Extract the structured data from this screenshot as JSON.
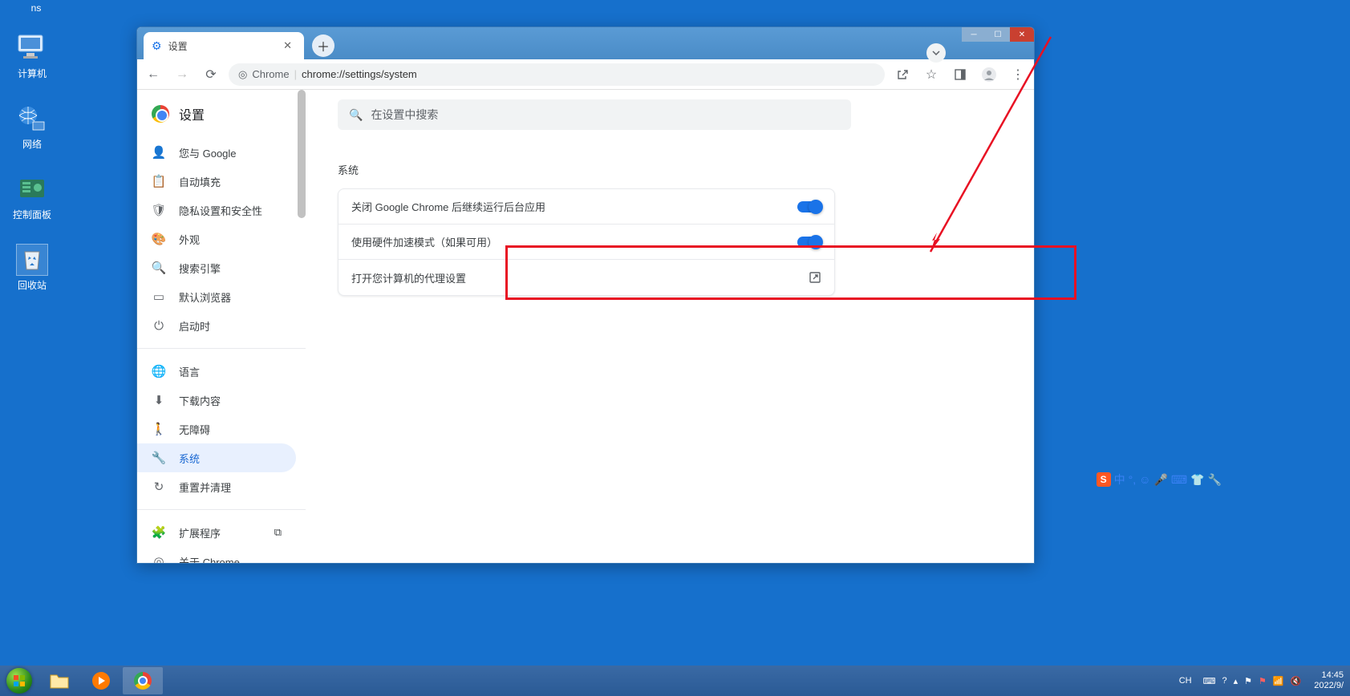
{
  "desktop": {
    "ns_text": "ns",
    "icons": [
      {
        "label": "计算机"
      },
      {
        "label": "网络"
      },
      {
        "label": "控制面板"
      },
      {
        "label": "回收站"
      }
    ]
  },
  "chrome": {
    "tab_title": "设置",
    "address_prefix": "Chrome",
    "address_path": "chrome://settings/system",
    "settings_title": "设置",
    "search_placeholder": "在设置中搜索",
    "section_title": "系统",
    "nav": [
      {
        "label": "您与 Google"
      },
      {
        "label": "自动填充"
      },
      {
        "label": "隐私设置和安全性"
      },
      {
        "label": "外观"
      },
      {
        "label": "搜索引擎"
      },
      {
        "label": "默认浏览器"
      },
      {
        "label": "启动时"
      }
    ],
    "nav2": [
      {
        "label": "语言"
      },
      {
        "label": "下载内容"
      },
      {
        "label": "无障碍"
      },
      {
        "label": "系统"
      },
      {
        "label": "重置并清理"
      }
    ],
    "nav3": [
      {
        "label": "扩展程序"
      },
      {
        "label": "关于 Chrome"
      }
    ],
    "rows": {
      "bg_apps": "关闭 Google Chrome 后继续运行后台应用",
      "hw_accel": "使用硬件加速模式（如果可用）",
      "proxy": "打开您计算机的代理设置"
    }
  },
  "taskbar": {
    "lang": "CH",
    "time": "14:45",
    "date": "2022/9/"
  },
  "ime": {
    "badge": "S",
    "mode": "中"
  }
}
